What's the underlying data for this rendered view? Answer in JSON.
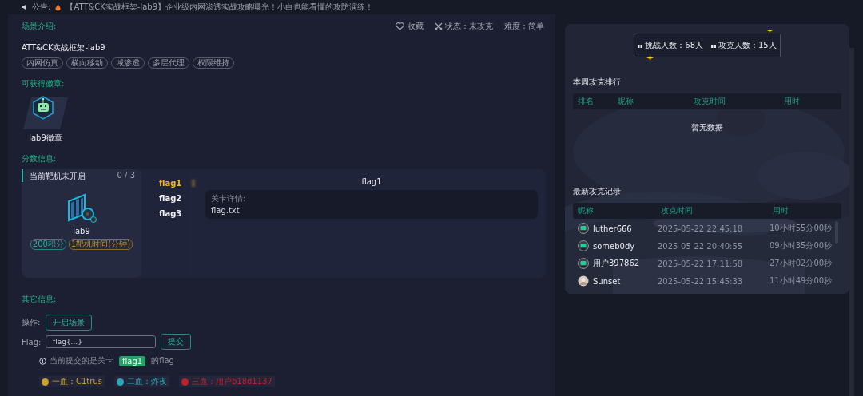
{
  "announcement": {
    "label": "公告:",
    "text": "【ATT&CK实战框架-lab9】企业级内网渗透实战攻略曝光！小白也能看懂的攻防演练！"
  },
  "scene": {
    "heading": "场景介绍:",
    "favorite": "收藏",
    "status": "状态：未攻克",
    "difficulty": "难度：简单",
    "title": "ATT&CK实战框架-lab9",
    "tags": [
      "内网仿真",
      "横向移动",
      "域渗透",
      "多层代理",
      "权限维持"
    ]
  },
  "badges": {
    "heading": "可获得徽章:",
    "items": [
      {
        "name": "lab9徽章"
      }
    ]
  },
  "score": {
    "heading": "分数信息:",
    "machine": {
      "status": "当前靶机未开启",
      "progress": "0 / 3",
      "name": "lab9",
      "points": "200积分",
      "time": "1靶机时间(分钟)"
    },
    "flags": [
      {
        "label": "flag1",
        "selected": true
      },
      {
        "label": "flag2",
        "selected": false
      },
      {
        "label": "flag3",
        "selected": false
      }
    ],
    "detail": {
      "title": "flag1",
      "label": "关卡详情:",
      "text": "flag.txt"
    }
  },
  "other": {
    "heading": "其它信息:",
    "operation_label": "操作:",
    "start_button": "开启场景",
    "flag_label": "Flag:",
    "flag_placeholder": "flag{...}",
    "submit_button": "提交",
    "hint_before": "当前提交的是关卡",
    "hint_flag": "flag1",
    "hint_after": "的flag",
    "bloods": [
      {
        "text": "一血：C1trus",
        "color": "#c9a227"
      },
      {
        "text": "二血：炸夜",
        "color": "#2aa6b8"
      },
      {
        "text": "三血：用户b18d1137",
        "color": "#c0202a"
      }
    ]
  },
  "stats": {
    "challengers": "挑战人数：68人",
    "solvers": "攻克人数：15人"
  },
  "weekly": {
    "heading": "本周攻克排行",
    "columns": [
      "排名",
      "昵称",
      "攻克时间",
      "用时"
    ],
    "empty": "暂无数据"
  },
  "records": {
    "heading": "最新攻克记录",
    "columns": [
      "昵称",
      "攻克时间",
      "用时"
    ],
    "rows": [
      {
        "kind": "robot",
        "name": "luther666",
        "time": "2025-05-22 22:45:18",
        "duration": "10小时55分00秒"
      },
      {
        "kind": "robot",
        "name": "someb0dy",
        "time": "2025-05-22 20:40:55",
        "duration": "09小时35分00秒"
      },
      {
        "kind": "robot",
        "name": "用户397862",
        "time": "2025-05-22 17:11:58",
        "duration": "27小时02分00秒"
      },
      {
        "kind": "person",
        "name": "Sunset",
        "time": "2025-05-22 15:45:33",
        "duration": "11小时49分00秒"
      }
    ]
  }
}
